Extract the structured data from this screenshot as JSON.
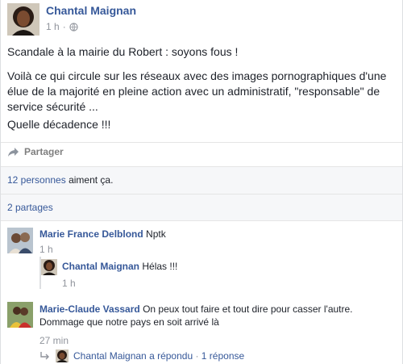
{
  "post": {
    "author": "Chantal Maignan",
    "time": "1 h",
    "separator": "·",
    "lines": [
      "Scandale à la mairie du Robert : soyons fous !",
      "Voilà ce qui circule sur les réseaux avec des images pornographiques d'une élue de la majorité en pleine action avec un administratif, \"responsable\" de service sécurité ...",
      "Quelle décadence !!!"
    ]
  },
  "actions": {
    "share_label": "Partager"
  },
  "reactions": {
    "likes_count": "12 personnes",
    "likes_suffix": " aiment ça.",
    "shares": "2 partages"
  },
  "comments": [
    {
      "name": "Marie France Delblond",
      "text": " Nptk",
      "time": "1 h",
      "replies": [
        {
          "name": "Chantal Maignan",
          "text": " Hélas !!!",
          "time": "1 h"
        }
      ]
    },
    {
      "name": "Marie-Claude Vassard",
      "text": " On peux tout faire et tout dire pour casser l'autre. Dommage que notre pays en soit arrivé là",
      "time": "27 min",
      "reply_summary": {
        "name": "Chantal Maignan",
        "action": " a répondu",
        "separator": " · ",
        "count": "1 réponse"
      }
    }
  ],
  "colors": {
    "link": "#365899",
    "meta": "#90949c",
    "text": "#1d2129",
    "panel": "#f6f7f9"
  },
  "icons": [
    "globe-icon",
    "share-arrow-icon",
    "reply-arrow-icon"
  ]
}
